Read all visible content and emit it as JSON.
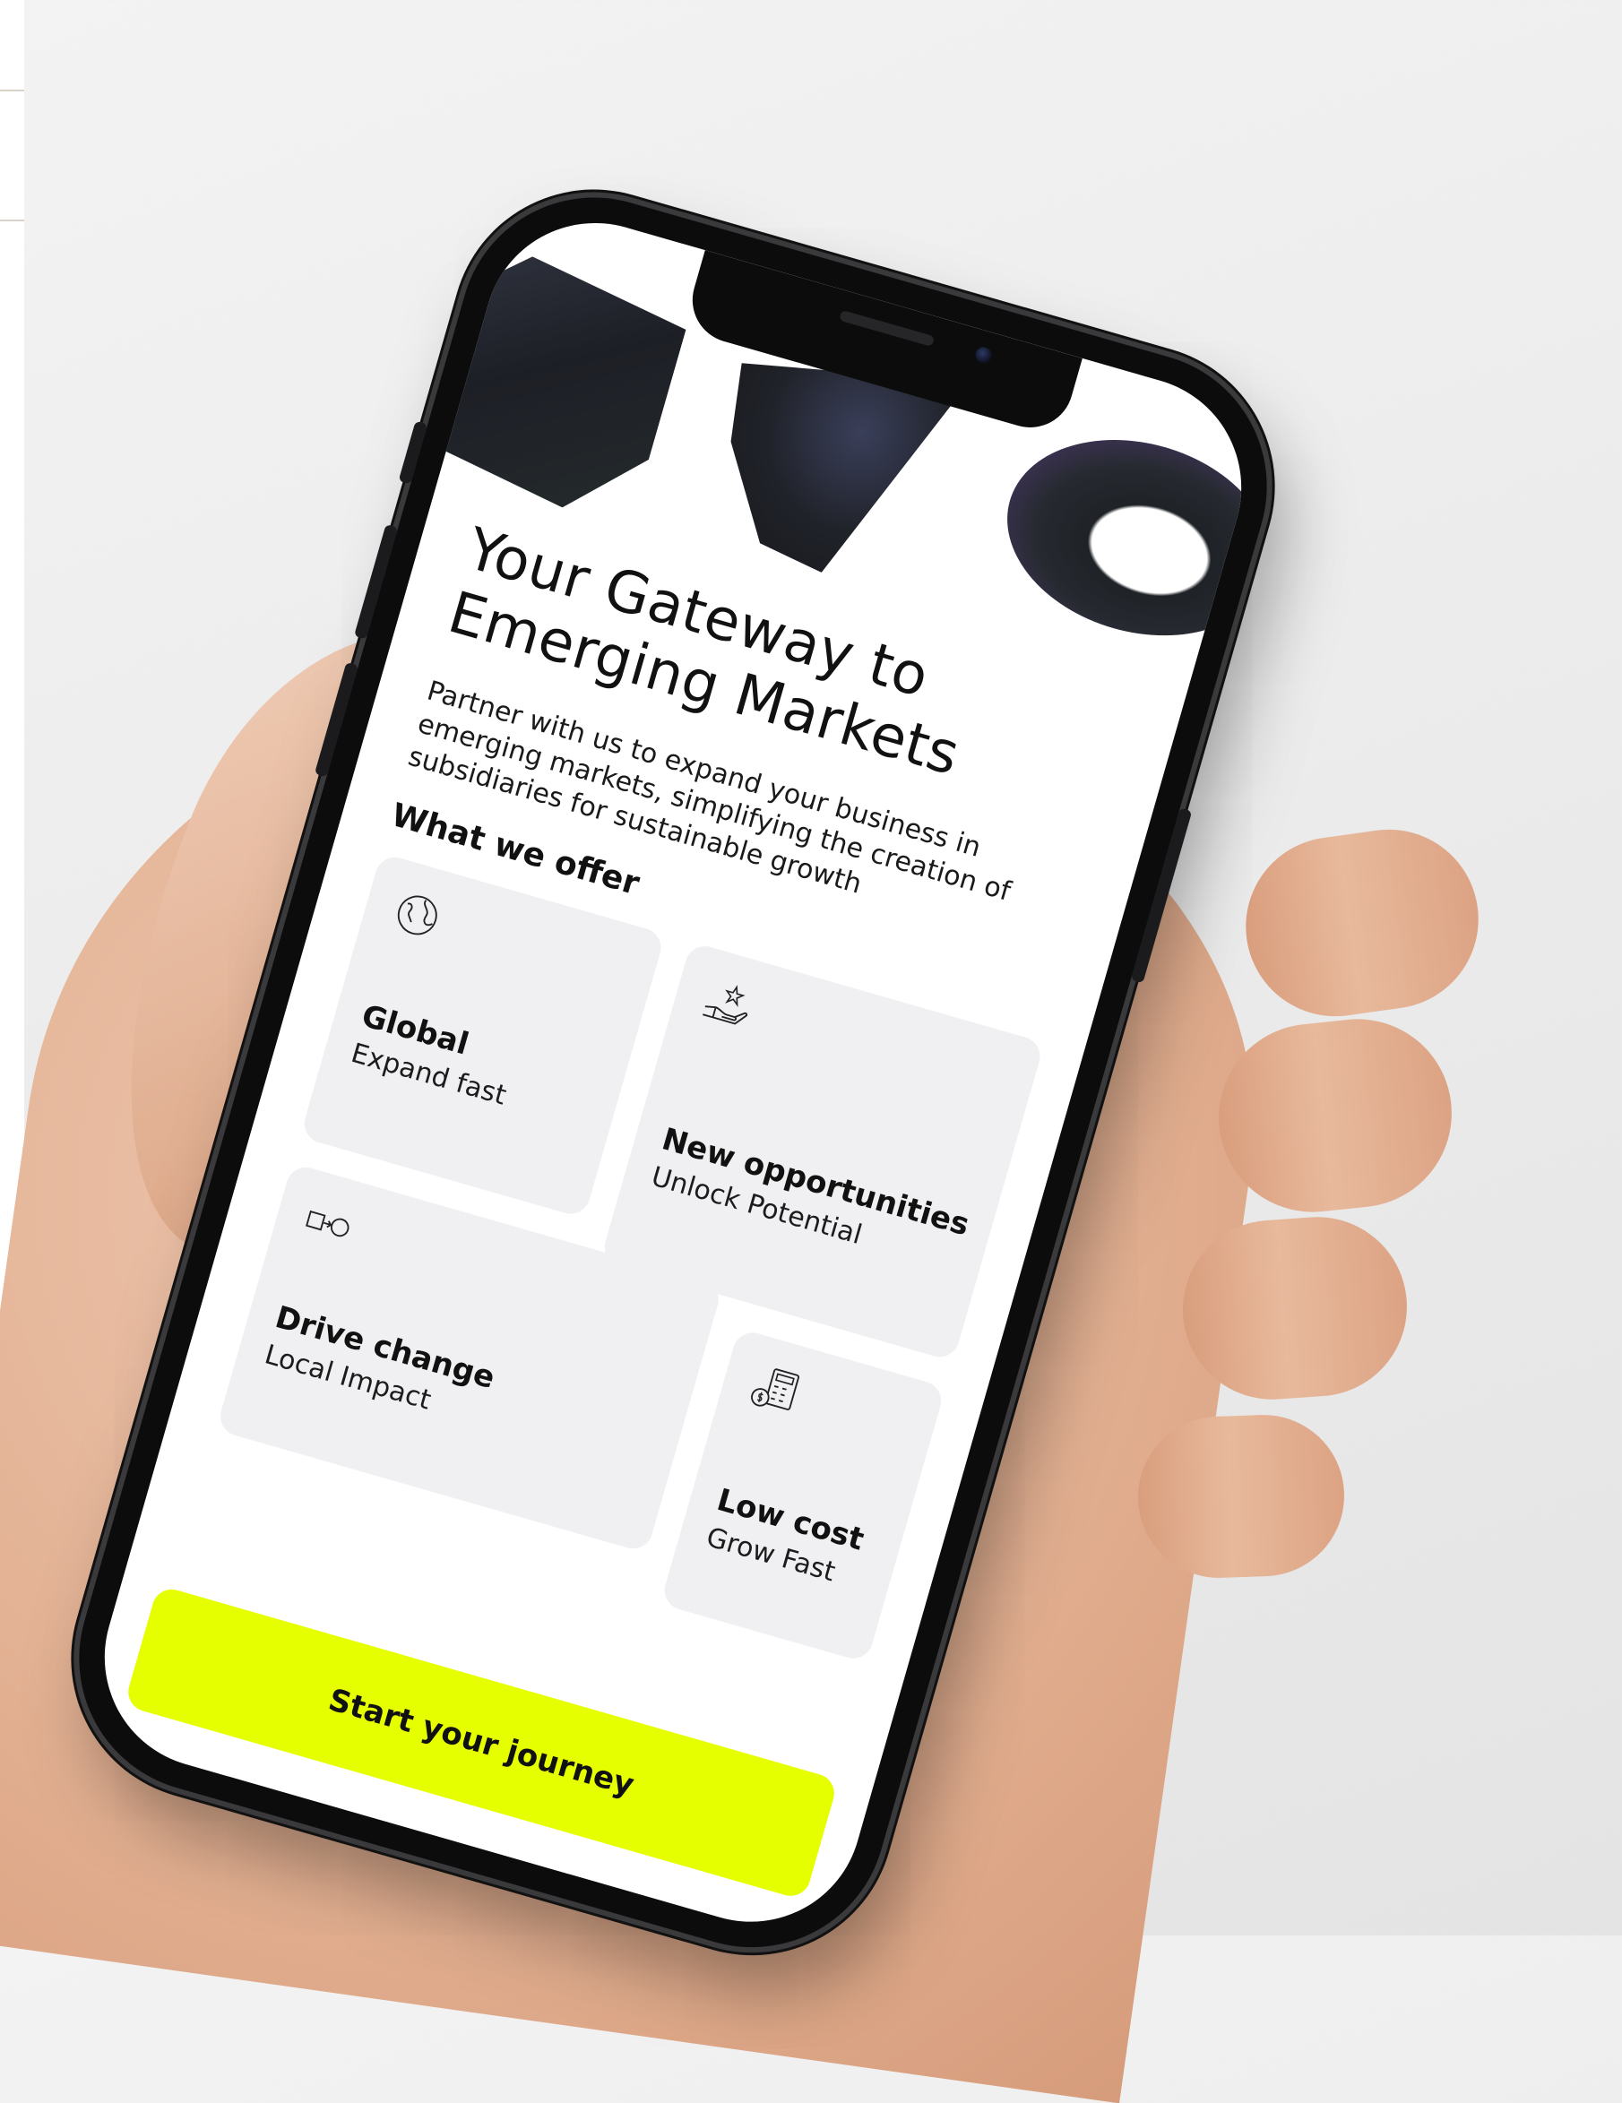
{
  "hero": {
    "headline_line1": "Your Gateway to",
    "headline_line2": "Emerging Markets",
    "subtitle": "Partner with us to expand your business in emerging markets, simplifying the creation of subsidiaries for sustainable growth"
  },
  "offer": {
    "section_title": "What we offer",
    "cards": [
      {
        "title": "Global",
        "subtitle": "Expand fast",
        "icon": "globe-icon"
      },
      {
        "title": "New opportunities",
        "subtitle": "Unlock Potential",
        "icon": "hand-star-icon"
      },
      {
        "title": "Drive change",
        "subtitle": "Local Impact",
        "icon": "square-to-circle-icon"
      },
      {
        "title": "Low cost",
        "subtitle": "Grow Fast",
        "icon": "calculator-coins-icon"
      }
    ]
  },
  "cta": {
    "label": "Start your journey"
  },
  "colors": {
    "accent": "#E5FF00",
    "card_background": "#F0F0F2",
    "text": "#111111"
  }
}
